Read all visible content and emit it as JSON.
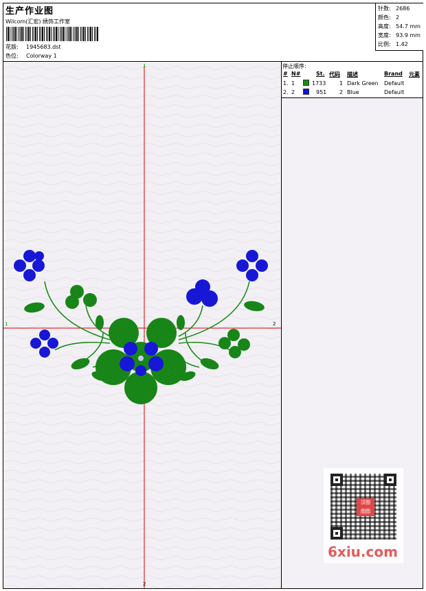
{
  "header": {
    "title": "生产作业图",
    "company": "Wilcom(汇宏) 绣饰工作室",
    "pattern_label": "花版:",
    "pattern_value": "1945683.dst",
    "colorway_label": "色位:",
    "colorway_value": "Colorway 1"
  },
  "stats": {
    "stitches_label": "针数:",
    "stitches_value": "2686",
    "colors_label": "颜色:",
    "colors_value": "2",
    "height_label": "高度:",
    "height_value": "54.7 mm",
    "width_label": "宽度:",
    "width_value": "93.9 mm",
    "scale_label": "比例:",
    "scale_value": "1.42"
  },
  "stop_sequence": {
    "title": "停止顺序:",
    "headers": {
      "hash": "#",
      "n": "N#",
      "st": "St.",
      "code": "代码",
      "desc": "描述",
      "brand": "Brand",
      "element": "元素"
    },
    "rows": [
      {
        "hash": "1.",
        "n": "1",
        "color": "#1a8a1a",
        "st": "1733",
        "code": "1",
        "desc": "Dark Green",
        "brand": "Default"
      },
      {
        "hash": "2.",
        "n": "2",
        "color": "#1010e0",
        "st": "951",
        "code": "2",
        "desc": "Blue",
        "brand": "Default"
      }
    ]
  },
  "canvas": {
    "axis_top": "1",
    "axis_left": "1",
    "axis_right": "2",
    "axis_bottom": "2",
    "colors": {
      "green": "#1a8a1a",
      "blue": "#1a1ae0",
      "axis": "#e00000"
    }
  },
  "watermark": {
    "seal_text": "汉图\n图图",
    "site": "6xiu.com"
  }
}
